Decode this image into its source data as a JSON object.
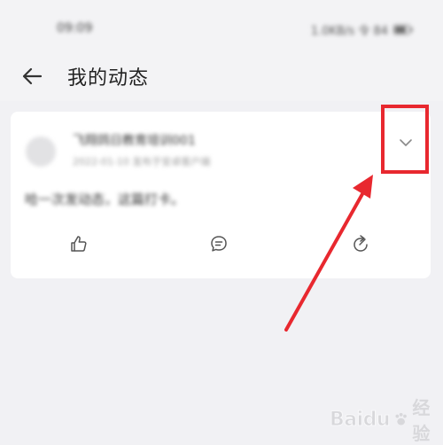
{
  "status_bar": {
    "time": "09:09",
    "indicators": "1.0KB/s 令 84"
  },
  "nav": {
    "back_icon": "arrow-left-icon",
    "title": "我的动态"
  },
  "post": {
    "author": "飞翔鸽日教育培训001",
    "meta": "2022-01-10  发布于安卓客户端",
    "content": "哈一次发动态，这篇打卡。",
    "more_icon": "chevron-down-icon",
    "actions": [
      "like-icon",
      "comment-icon",
      "share-icon"
    ]
  },
  "annotation": {
    "color": "#e8282f"
  },
  "watermark": {
    "brand": "Baidu",
    "suffix": "经验"
  }
}
